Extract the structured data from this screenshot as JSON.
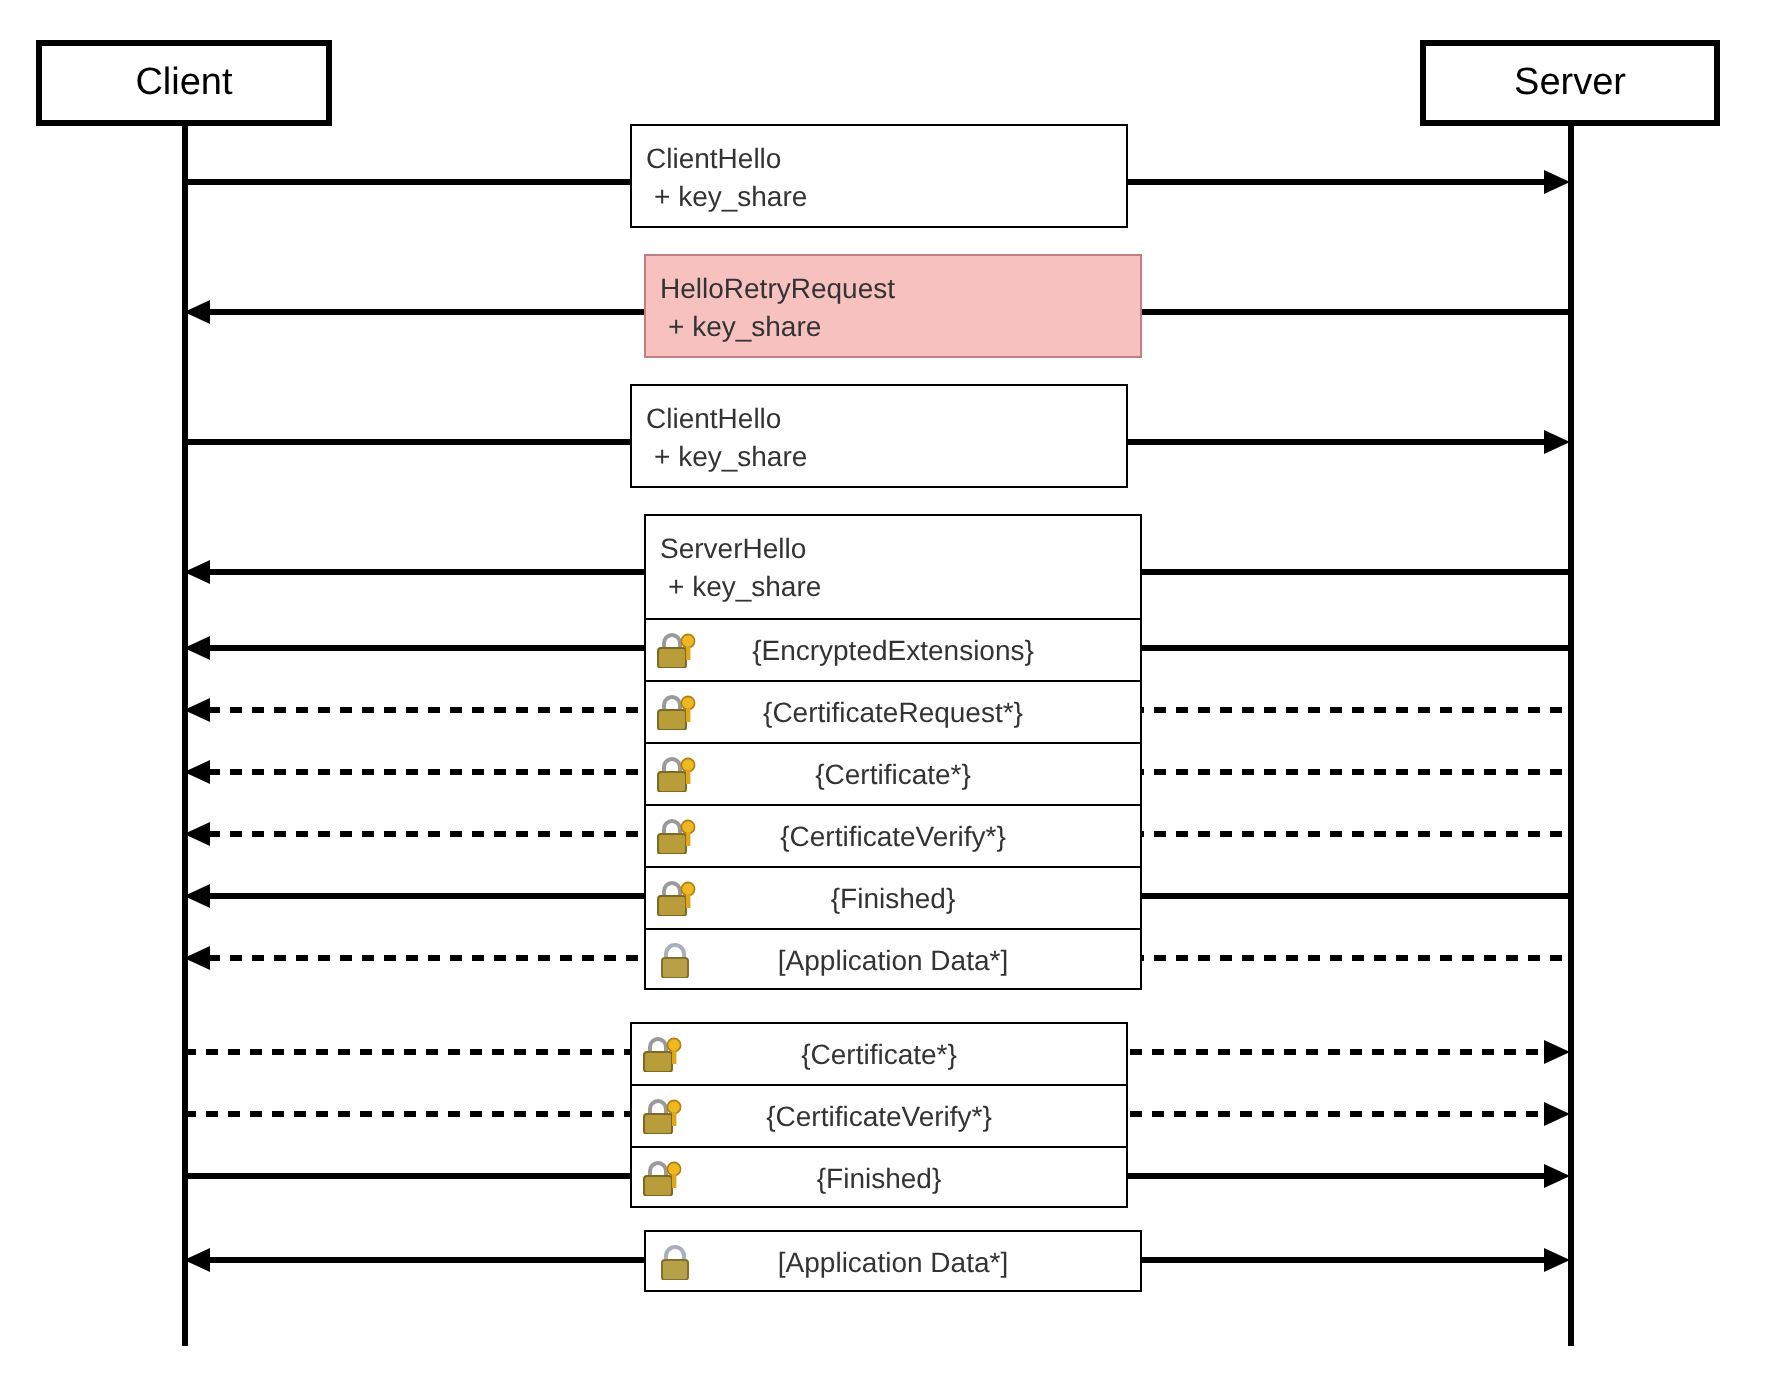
{
  "participants": [
    {
      "label": "Client"
    },
    {
      "label": "Server"
    }
  ],
  "groups": [
    {
      "messages": [
        {
          "lines": [
            "ClientHello",
            "+ key_share"
          ],
          "kind": "send",
          "highlighted": false
        }
      ]
    },
    {
      "messages": [
        {
          "lines": [
            "HelloRetryRequest",
            "+ key_share"
          ],
          "kind": "reply",
          "highlighted": true
        }
      ]
    },
    {
      "messages": [
        {
          "lines": [
            "ClientHello",
            "+ key_share"
          ],
          "kind": "send",
          "highlighted": false
        }
      ]
    },
    {
      "messages": [
        {
          "lines": [
            "ServerHello",
            "+ key_share"
          ],
          "kind": "reply",
          "highlighted": false
        },
        {
          "lines": [
            "{EncryptedExtensions}"
          ],
          "lock": {
            "kind": "keyed"
          },
          "kind": "reply",
          "highlighted": false
        },
        {
          "lines": [
            "{CertificateRequest*}"
          ],
          "lock": {
            "kind": "keyed"
          },
          "kind": "optionalreply",
          "highlighted": false
        },
        {
          "lines": [
            "{Certificate*}"
          ],
          "lock": {
            "kind": "keyed"
          },
          "kind": "optionalreply",
          "highlighted": false
        },
        {
          "lines": [
            "{CertificateVerify*}"
          ],
          "lock": {
            "kind": "keyed"
          },
          "kind": "optionalreply",
          "highlighted": false
        },
        {
          "lines": [
            "{Finished}"
          ],
          "lock": {
            "kind": "keyed"
          },
          "kind": "reply",
          "highlighted": false
        },
        {
          "lines": [
            "[Application Data*]"
          ],
          "lock": {
            "kind": "plain"
          },
          "kind": "optionalreply",
          "highlighted": false
        }
      ]
    },
    {
      "messages": [
        {
          "lines": [
            "{Certificate*}"
          ],
          "lock": {
            "kind": "keyed"
          },
          "kind": "optionalsend",
          "highlighted": false
        },
        {
          "lines": [
            "{CertificateVerify*}"
          ],
          "lock": {
            "kind": "keyed"
          },
          "kind": "optionalsend",
          "highlighted": false
        },
        {
          "lines": [
            "{Finished}"
          ],
          "lock": {
            "kind": "keyed"
          },
          "kind": "send",
          "highlighted": false
        }
      ]
    },
    {
      "messages": [
        {
          "lines": [
            "[Application Data*]"
          ],
          "lock": {
            "kind": "plain"
          },
          "kind": "exchange",
          "highlighted": false
        }
      ]
    }
  ]
}
